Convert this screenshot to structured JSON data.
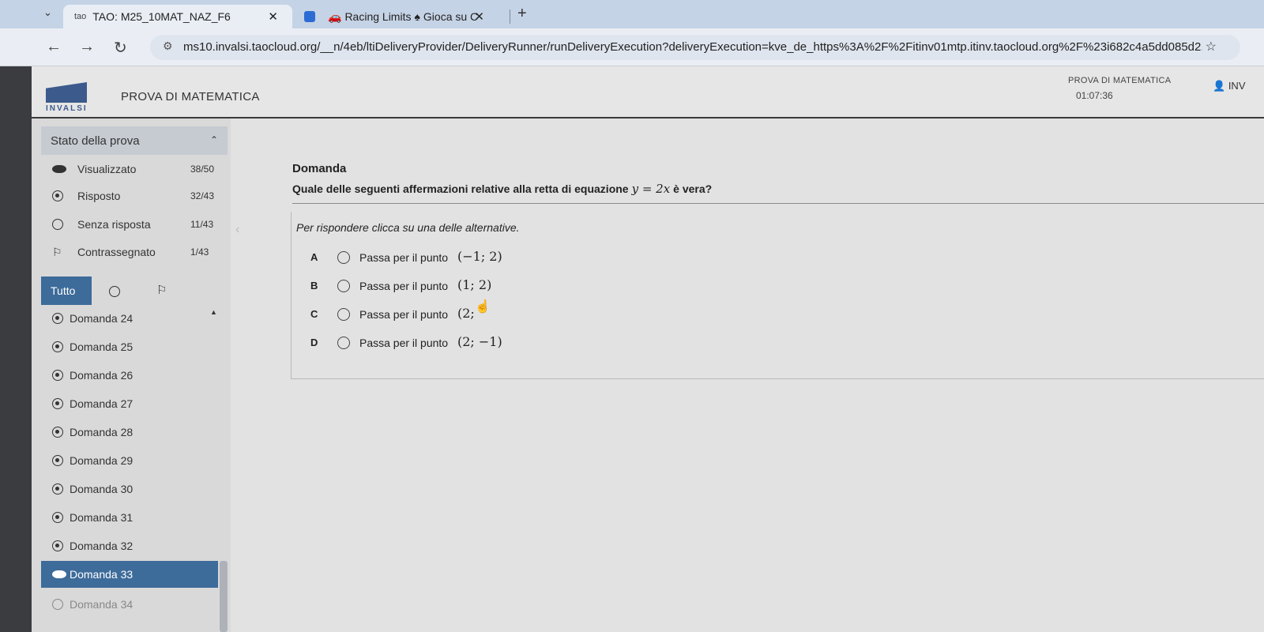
{
  "browser": {
    "tab1_favicon": "tao",
    "tab1_title": "TAO: M25_10MAT_NAZ_F6",
    "tab2_title": "Racing Limits",
    "tab2_extra": "Gioca su C",
    "close_glyph": "✕",
    "new_tab_glyph": "+",
    "url": "ms10.invalsi.taocloud.org/__n/4eb/ltiDeliveryProvider/DeliveryRunner/runDeliveryExecution?deliveryExecution=kve_de_https%3A%2F%2Fitinv01mtp.itinv.taocloud.org%2F%23i682c4a5dd085d2..."
  },
  "header": {
    "logo_text": "INVALSI",
    "title": "PROVA DI MATEMATICA",
    "right_title": "PROVA DI MATEMATICA",
    "timer": "01:07:36",
    "user": "INV"
  },
  "sidebar": {
    "status_title": "Stato della prova",
    "stats": [
      {
        "label": "Visualizzato",
        "count": "38/50"
      },
      {
        "label": "Risposto",
        "count": "32/43"
      },
      {
        "label": "Senza risposta",
        "count": "11/43"
      },
      {
        "label": "Contrassegnato",
        "count": "1/43"
      }
    ],
    "filter_all": "Tutto",
    "questions": [
      {
        "label": "Domanda 24",
        "state": "answered"
      },
      {
        "label": "Domanda 25",
        "state": "answered"
      },
      {
        "label": "Domanda 26",
        "state": "answered"
      },
      {
        "label": "Domanda 27",
        "state": "answered"
      },
      {
        "label": "Domanda 28",
        "state": "answered"
      },
      {
        "label": "Domanda 29",
        "state": "answered"
      },
      {
        "label": "Domanda 30",
        "state": "answered"
      },
      {
        "label": "Domanda 31",
        "state": "answered"
      },
      {
        "label": "Domanda 32",
        "state": "answered"
      },
      {
        "label": "Domanda 33",
        "state": "current"
      },
      {
        "label": "Domanda 34",
        "state": "unanswered"
      }
    ]
  },
  "question": {
    "heading": "Domanda",
    "text_before": "Quale delle seguenti affermazioni relative alla retta di equazione",
    "equation": "y = 2x",
    "text_after": "è vera?",
    "instruction": "Per rispondere clicca su una delle alternative.",
    "choices": [
      {
        "letter": "A",
        "text": "Passa per il punto",
        "point": "(−1; 2)"
      },
      {
        "letter": "B",
        "text": "Passa per il punto",
        "point": "(1; 2)"
      },
      {
        "letter": "C",
        "text": "Passa per il punto",
        "point": "(2; "
      },
      {
        "letter": "D",
        "text": "Passa per il punto",
        "point": "(2; −1)"
      }
    ]
  }
}
